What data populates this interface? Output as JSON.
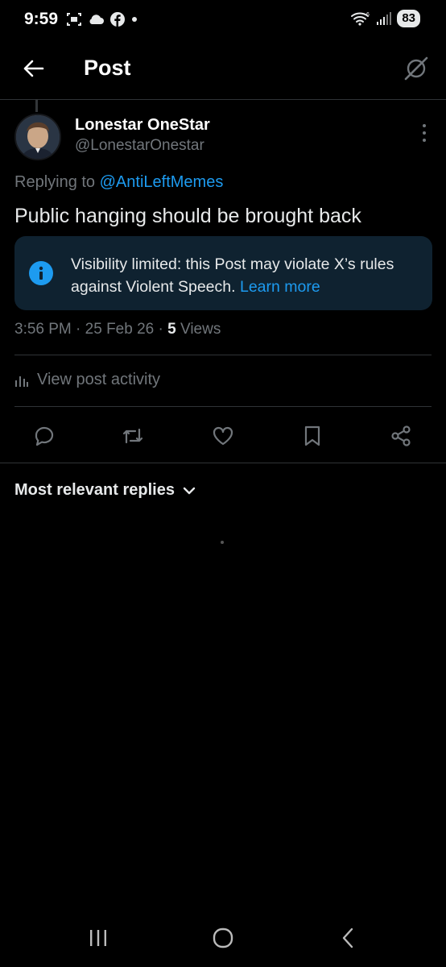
{
  "status_bar": {
    "time": "9:59",
    "battery": "83",
    "left_icons": [
      "screenshot-icon",
      "cloud-icon",
      "facebook-icon",
      "dot-icon"
    ],
    "right_icons": [
      "wifi-icon",
      "signal-icon"
    ]
  },
  "header": {
    "title": "Post",
    "back_icon": "back-arrow-icon",
    "grok_icon": "grok-icon"
  },
  "post": {
    "author_name": "Lonestar OneStar",
    "author_handle": "@LonestarOnestar",
    "replying_prefix": "Replying to ",
    "replying_to": "@AntiLeftMemes",
    "text": "Public hanging should be brought back",
    "notice_text": "Visibility limited: this Post may violate X’s rules against Violent Speech. ",
    "notice_link": "Learn more",
    "time": "3:56 PM",
    "date": "25 Feb 26",
    "views_count": "5",
    "views_label": "Views",
    "separator": " · "
  },
  "activity": {
    "label": "View post activity"
  },
  "actions": [
    "reply-icon",
    "repost-icon",
    "like-icon",
    "bookmark-icon",
    "share-icon"
  ],
  "replies": {
    "sort_label": "Most relevant replies"
  },
  "colors": {
    "background": "#000000",
    "accent": "#1d9bf0",
    "secondary_text": "#71767b",
    "notice_bg": "#0f2230"
  }
}
